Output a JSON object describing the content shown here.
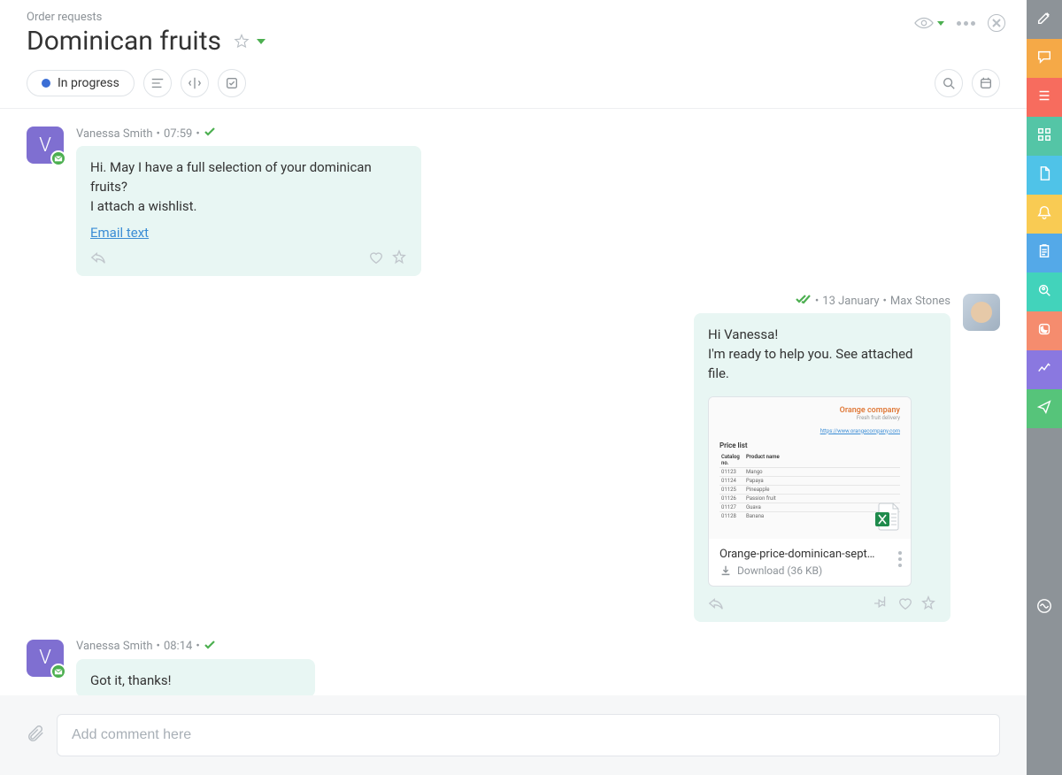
{
  "header": {
    "breadcrumb": "Order requests",
    "title": "Dominican fruits"
  },
  "toolbar": {
    "status_label": "In progress",
    "status_color": "#3b6ed5"
  },
  "messages": [
    {
      "id": "m1",
      "side": "incoming",
      "author": "Vanessa Smith",
      "time": "07:59",
      "avatar_initial": "V",
      "delivery": "single",
      "text": "Hi. May I have a full selection of your dominican fruits?\nI attach a wishlist.",
      "link_label": "Email text"
    },
    {
      "id": "m2",
      "side": "outgoing",
      "author": "Max Stones",
      "time": "13 January",
      "delivery": "double",
      "text": "Hi Vanessa!\nI'm ready to help you. See attached file.",
      "attachment": {
        "preview_company": "Orange company",
        "preview_subtitle": "Fresh fruit delivery",
        "preview_link": "https://www.orangecompany.com",
        "preview_heading": "Price list",
        "preview_headers": [
          "Catalog no.",
          "Product name"
        ],
        "preview_rows": [
          [
            "01123",
            "Mango"
          ],
          [
            "01124",
            "Papaya"
          ],
          [
            "01125",
            "Pineapple"
          ],
          [
            "01126",
            "Passion fruit"
          ],
          [
            "01127",
            "Guava"
          ],
          [
            "01128",
            "Banana"
          ]
        ],
        "filename": "Orange-price-dominican-sept…",
        "download_label": "Download (36 KB)"
      }
    },
    {
      "id": "m3",
      "side": "incoming",
      "author": "Vanessa Smith",
      "time": "08:14",
      "avatar_initial": "V",
      "delivery": "single",
      "text": "Got it, thanks!"
    }
  ],
  "comment": {
    "placeholder": "Add comment here"
  },
  "rightbar": {
    "items": [
      {
        "name": "edit-icon",
        "color": "rb-grey"
      },
      {
        "name": "chat-icon",
        "color": "rb-orange1"
      },
      {
        "name": "list-icon",
        "color": "rb-orange2"
      },
      {
        "name": "apps-icon",
        "color": "rb-teal"
      },
      {
        "name": "file-icon",
        "color": "rb-cyan"
      },
      {
        "name": "bell-icon",
        "color": "rb-yellow"
      },
      {
        "name": "clipboard-icon",
        "color": "rb-blue"
      },
      {
        "name": "search-person-icon",
        "color": "rb-mint"
      },
      {
        "name": "phone-icon",
        "color": "rb-coral"
      },
      {
        "name": "analytics-icon",
        "color": "rb-purple"
      },
      {
        "name": "send-icon",
        "color": "rb-green"
      },
      {
        "name": "wave-icon",
        "color": "rb-grey2"
      }
    ]
  }
}
